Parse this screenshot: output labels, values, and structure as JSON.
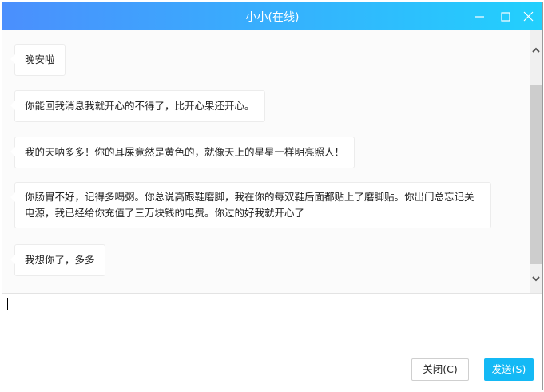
{
  "window": {
    "title": "小小(在线)"
  },
  "messages": [
    {
      "text": "晚安啦"
    },
    {
      "text": "你能回我消息我就开心的不得了，比开心果还开心。"
    },
    {
      "text": "我的天呐多多！你的耳屎竟然是黄色的，就像天上的星星一样明亮照人！"
    },
    {
      "text": "你肠胃不好，记得多喝粥。你总说高跟鞋磨脚，我在你的每双鞋后面都贴上了磨脚贴。你出门总忘记关电源，我已经给你充值了三万块钱的电费。你过的好我就开心了"
    },
    {
      "text": "我想你了，多多"
    }
  ],
  "input": {
    "value": ""
  },
  "buttons": {
    "close": "关闭(C)",
    "send": "发送(S)"
  },
  "colors": {
    "title_start": "#4b8ffd",
    "title_end": "#22d0fd",
    "send": "#14b9f5"
  }
}
